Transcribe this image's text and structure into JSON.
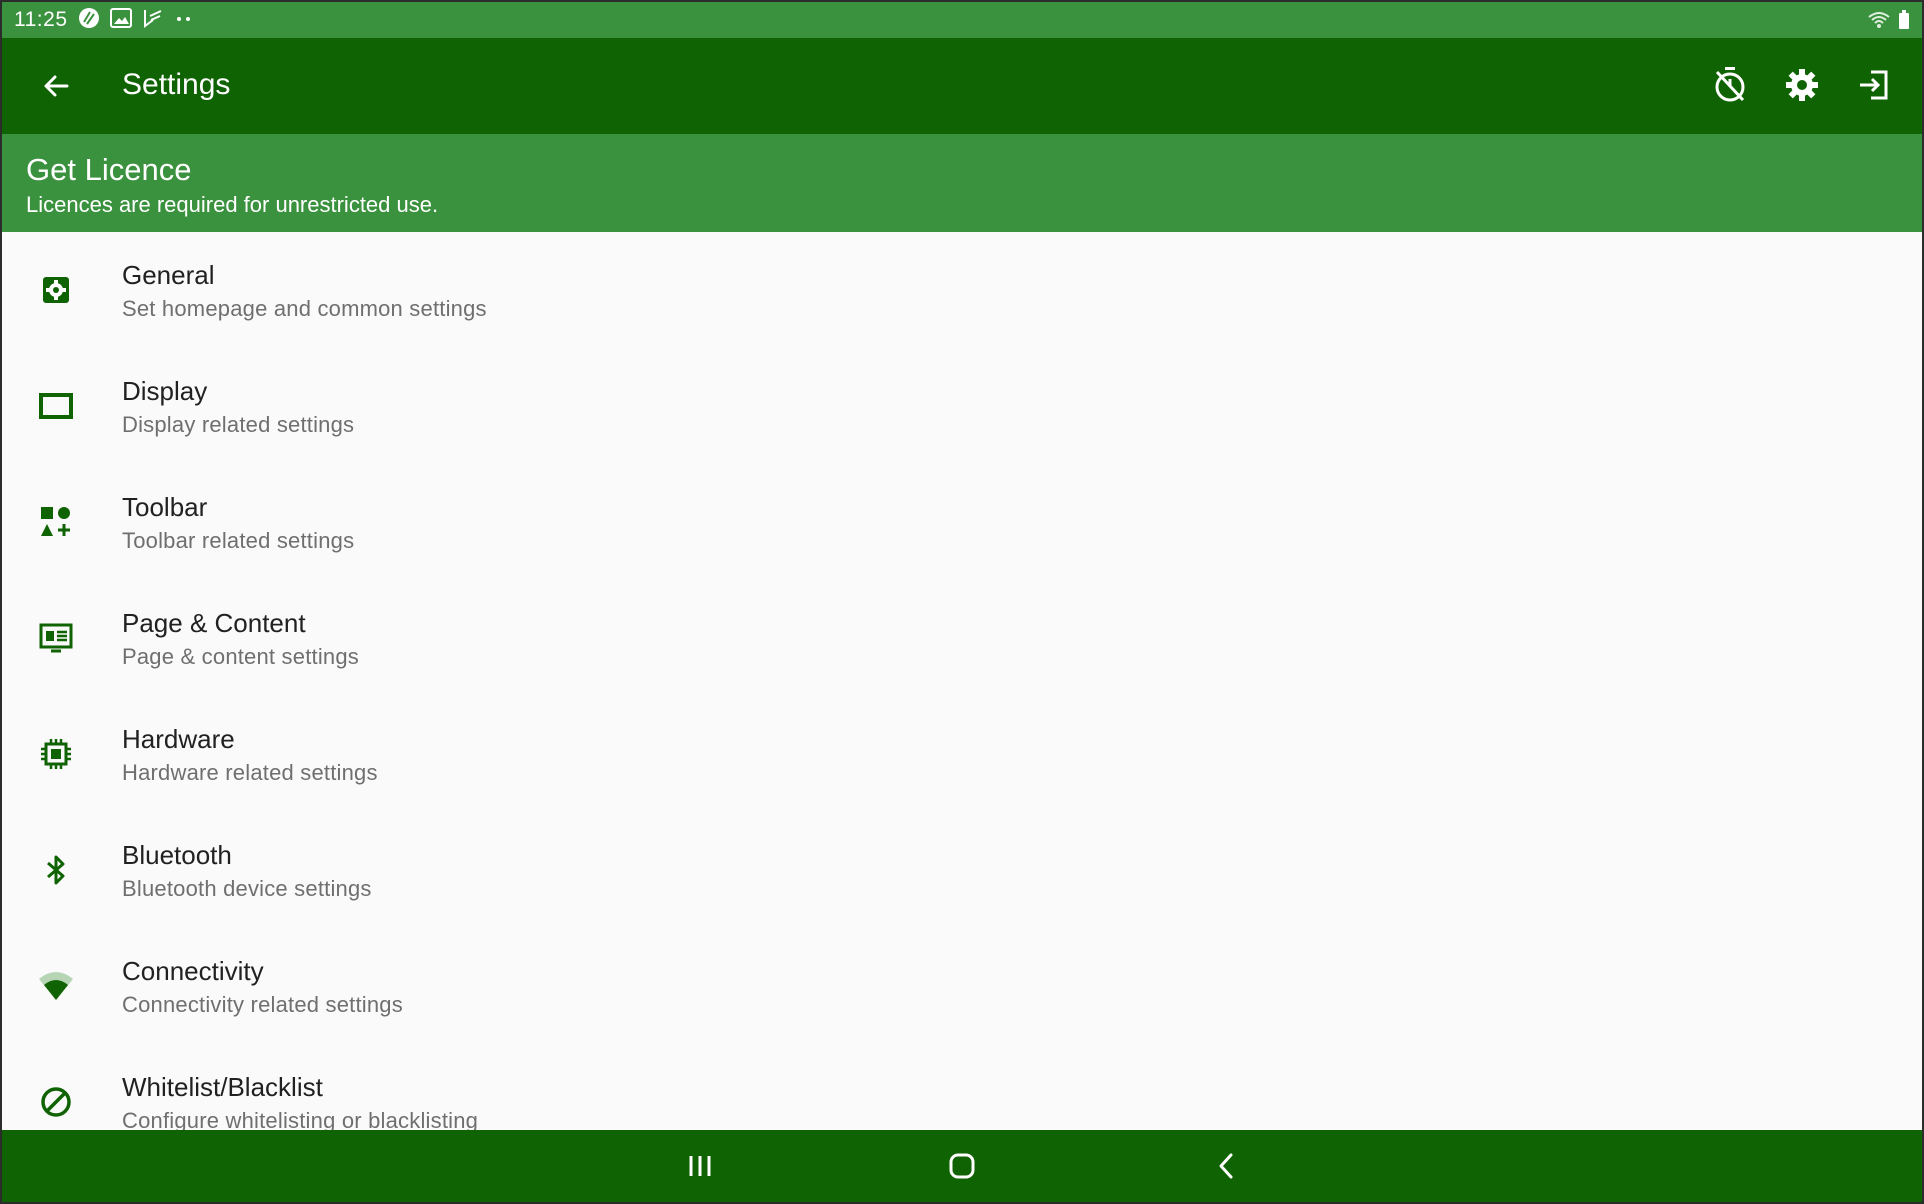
{
  "status_bar": {
    "time": "11:25",
    "icons": [
      "app-icon",
      "image-icon",
      "play-icon",
      "more-dots-icon"
    ],
    "right_icons": [
      "wifi-icon",
      "battery-icon"
    ]
  },
  "app_bar": {
    "title": "Settings",
    "back_icon": "arrow-back-icon",
    "actions": [
      "timer-off-icon",
      "gear-icon",
      "exit-icon"
    ]
  },
  "licence_banner": {
    "title": "Get Licence",
    "subtitle": "Licences are required for unrestricted use."
  },
  "settings": [
    {
      "label": "General",
      "sub": "Set homepage and common settings",
      "icon": "settings-box-icon"
    },
    {
      "label": "Display",
      "sub": "Display related settings",
      "icon": "display-icon"
    },
    {
      "label": "Toolbar",
      "sub": "Toolbar related settings",
      "icon": "shapes-icon"
    },
    {
      "label": "Page & Content",
      "sub": "Page & content settings",
      "icon": "content-icon"
    },
    {
      "label": "Hardware",
      "sub": "Hardware related settings",
      "icon": "chip-icon"
    },
    {
      "label": "Bluetooth",
      "sub": "Bluetooth device settings",
      "icon": "bluetooth-icon"
    },
    {
      "label": "Connectivity",
      "sub": "Connectivity related settings",
      "icon": "wifi-icon"
    },
    {
      "label": "Whitelist/Blacklist",
      "sub": "Configure whitelisting or blacklisting",
      "icon": "block-icon"
    }
  ],
  "nav_bar": [
    "recents-icon",
    "home-icon",
    "back-icon"
  ],
  "colors": {
    "primary_dark": "#106303",
    "primary": "#3b923e",
    "icon_green": "#106303",
    "background": "#fafafa"
  }
}
